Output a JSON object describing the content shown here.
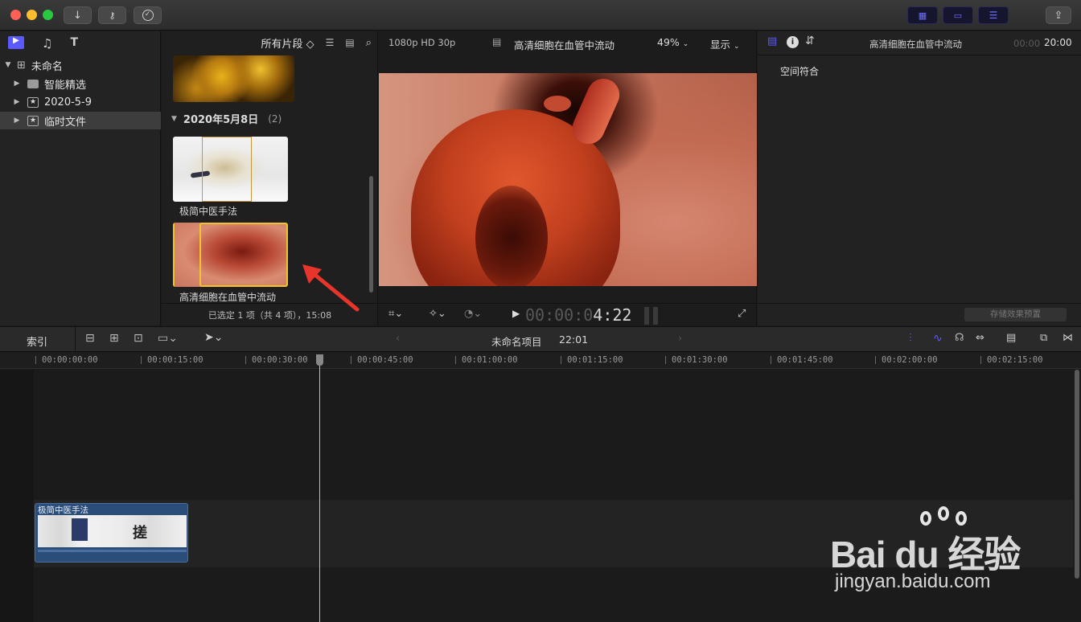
{
  "toolbar": {
    "import_icon": "download-arrow-icon",
    "keyword_icon": "key-icon",
    "analyze_icon": "checkmark-circle-icon",
    "share_icon": "share-icon"
  },
  "sidebar": {
    "library": "未命名",
    "items": [
      {
        "label": "智能精选",
        "icon": "folder-icon"
      },
      {
        "label": "2020-5-9",
        "icon": "star-event-icon"
      },
      {
        "label": "临时文件",
        "icon": "star-event-icon"
      }
    ]
  },
  "browser": {
    "filter": "所有片段 ◇",
    "group_title": "2020年5月8日",
    "group_count": "(2)",
    "clips": [
      {
        "name": "极简中医手法"
      },
      {
        "name": "高清细胞在血管中流动"
      }
    ],
    "status": "已选定 1 项（共 4 项），15:08"
  },
  "viewer": {
    "format": "1080p HD 30p",
    "clip_title": "高清细胞在血管中流动",
    "zoom": "49%",
    "display_menu": "显示",
    "timecode_dim": "00:00:0",
    "timecode_bright": "4:22"
  },
  "inspector": {
    "title": "高清细胞在血管中流动",
    "duration_dim": "00:00",
    "duration": "20:00",
    "section": "空间符合",
    "save_preset": "存储效果预置"
  },
  "timeline": {
    "index_label": "索引",
    "project_name": "未命名项目",
    "project_duration": "22:01",
    "ruler": [
      "00:00:00:00",
      "00:00:15:00",
      "00:00:30:00",
      "00:00:45:00",
      "00:01:00:00",
      "00:01:15:00",
      "00:01:30:00",
      "00:01:45:00",
      "00:02:00:00",
      "00:02:15:00"
    ],
    "clip_name": "极简中医手法",
    "clip_glyph": "搓"
  },
  "watermark": {
    "brand": "Bai du 经验",
    "url": "jingyan.baidu.com"
  },
  "colors": {
    "accent_blue": "#5a5aff",
    "selection_yellow": "#f2c12e",
    "annotation_red": "#e8352b",
    "clip_blue": "#2b4d7a"
  }
}
